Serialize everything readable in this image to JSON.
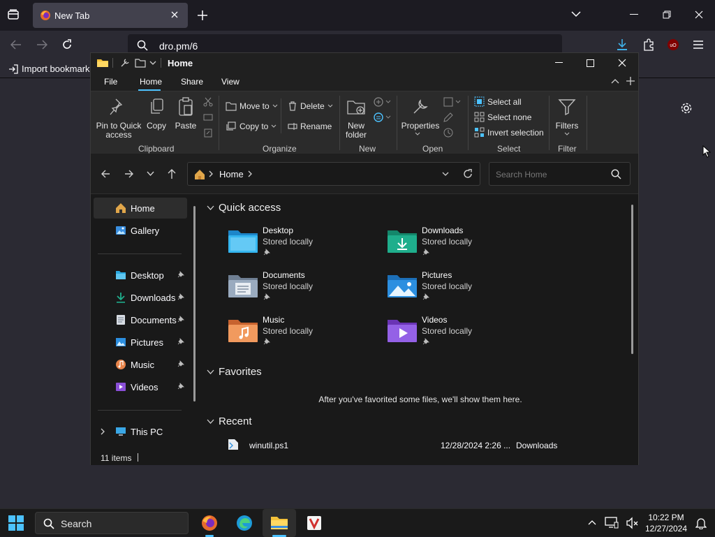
{
  "browser": {
    "tab_title": "New Tab",
    "url": "dro.pm/6",
    "bookmark_label": "Import bookmarks"
  },
  "explorer": {
    "title": "Home",
    "menu_tabs": [
      "File",
      "Home",
      "Share",
      "View"
    ],
    "active_tab": "Home",
    "ribbon": {
      "pin_label_1": "Pin to Quick",
      "pin_label_2": "access",
      "copy": "Copy",
      "paste": "Paste",
      "move_to": "Move to",
      "copy_to": "Copy to",
      "delete": "Delete",
      "rename": "Rename",
      "new_folder_1": "New",
      "new_folder_2": "folder",
      "properties": "Properties",
      "select_all": "Select all",
      "select_none": "Select none",
      "invert_selection": "Invert selection",
      "filters": "Filters",
      "groups": {
        "clipboard": "Clipboard",
        "organize": "Organize",
        "new": "New",
        "open": "Open",
        "select": "Select",
        "filter": "Filter"
      }
    },
    "address": {
      "crumb": "Home",
      "search_placeholder": "Search Home"
    },
    "nav": {
      "top": [
        {
          "label": "Home",
          "icon": "home-icon"
        },
        {
          "label": "Gallery",
          "icon": "gallery-icon"
        }
      ],
      "pinned": [
        {
          "label": "Desktop",
          "icon": "desktop-folder-icon"
        },
        {
          "label": "Downloads",
          "icon": "downloads-icon"
        },
        {
          "label": "Documents",
          "icon": "documents-icon"
        },
        {
          "label": "Pictures",
          "icon": "pictures-icon"
        },
        {
          "label": "Music",
          "icon": "music-icon"
        },
        {
          "label": "Videos",
          "icon": "videos-icon"
        }
      ],
      "this_pc": "This PC"
    },
    "sections": {
      "quick_access": "Quick access",
      "favorites": "Favorites",
      "recent": "Recent",
      "favorites_empty": "After you've favorited some files, we'll show them here."
    },
    "quick_access": [
      {
        "name": "Desktop",
        "status": "Stored locally",
        "color": "#29a8e0"
      },
      {
        "name": "Downloads",
        "status": "Stored locally",
        "color": "#1fae8c"
      },
      {
        "name": "Documents",
        "status": "Stored locally",
        "color": "#8a9bb0"
      },
      {
        "name": "Pictures",
        "status": "Stored locally",
        "color": "#2c8fe0"
      },
      {
        "name": "Music",
        "status": "Stored locally",
        "color": "#e8844a"
      },
      {
        "name": "Videos",
        "status": "Stored locally",
        "color": "#8a4fd8"
      }
    ],
    "recent": [
      {
        "name": "winutil.ps1",
        "date": "12/28/2024 2:26 ...",
        "location": "Downloads"
      }
    ],
    "status": "11 items"
  },
  "taskbar": {
    "search_label": "Search",
    "time": "10:22 PM",
    "date": "12/27/2024"
  }
}
